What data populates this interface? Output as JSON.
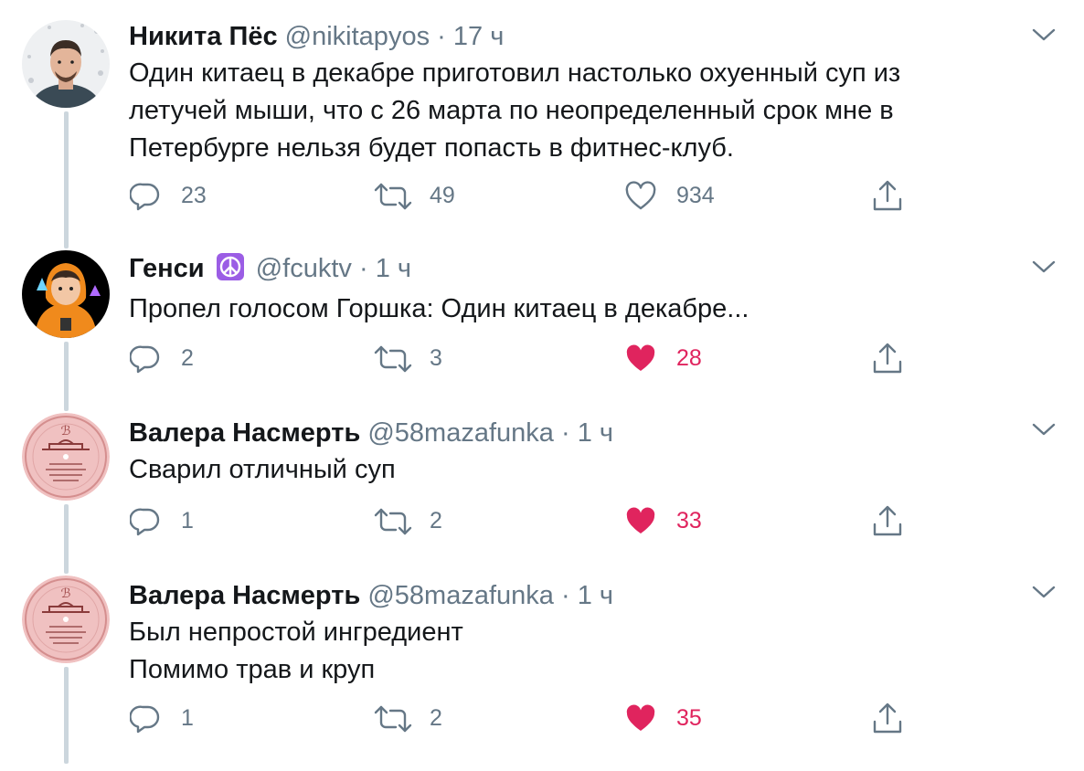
{
  "colors": {
    "like_active": "#e0245e",
    "secondary_text": "#657786",
    "thread_line": "#ccd6dd"
  },
  "tweets": [
    {
      "name": "Никита Пёс",
      "handle": "@nikitapyos",
      "separator": "·",
      "time": "17 ч",
      "text": "Один китаец в декабре приготовил настолько охуенный суп из\nлетучей мыши, что с 26 марта по неопределенный срок мне в\nПетербурге нельзя будет попасть в фитнес-клуб.",
      "replies": "23",
      "retweets": "49",
      "likes": "934",
      "liked": false
    },
    {
      "name": "Генси",
      "badge_icon": "peace-symbol-icon",
      "handle": "@fcuktv",
      "separator": "·",
      "time": "1 ч",
      "text": "Пропел голосом Горшка: Один китаец в декабре...",
      "replies": "2",
      "retweets": "3",
      "likes": "28",
      "liked": true
    },
    {
      "name": "Валера Насмерть",
      "handle": "@58mazafunka",
      "separator": "·",
      "time": "1 ч",
      "text": "Сварил отличный суп",
      "replies": "1",
      "retweets": "2",
      "likes": "33",
      "liked": true
    },
    {
      "name": "Валера Насмерть",
      "handle": "@58mazafunka",
      "separator": "·",
      "time": "1 ч",
      "text": "Был непростой ингредиент\nПомимо трав и круп",
      "replies": "1",
      "retweets": "2",
      "likes": "35",
      "liked": true
    }
  ]
}
